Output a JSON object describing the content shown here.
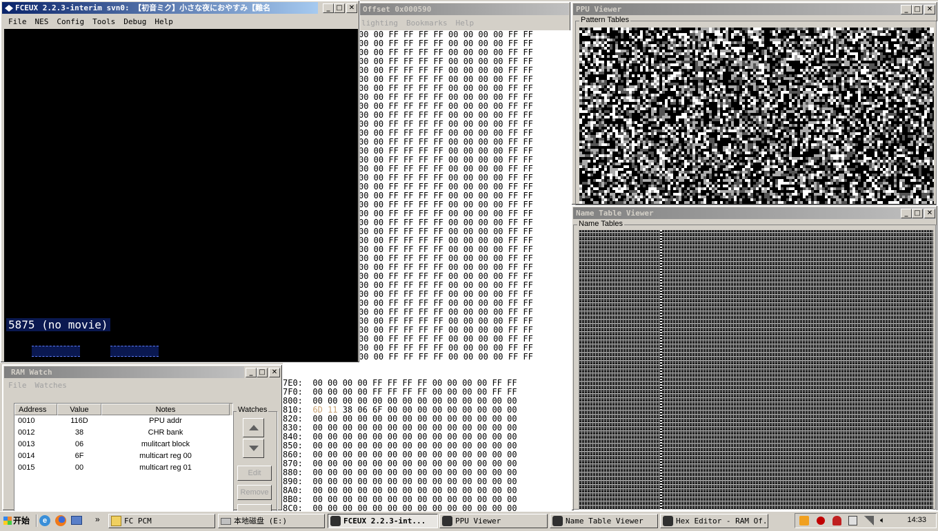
{
  "hex_editor": {
    "title": "Offset 0x000590",
    "menu": [
      "lighting",
      "Bookmarks",
      "Help"
    ],
    "ff_row": "00 00 FF FF FF FF 00 00 00 00 FF FF",
    "bottom_rows": [
      {
        "addr": "7E0:",
        "bytes": "00 00 00 00 FF FF FF FF 00 00 00 00 FF FF"
      },
      {
        "addr": "7F0:",
        "bytes": "00 00 00 00 FF FF FF FF 00 00 00 00 FF FF"
      },
      {
        "addr": "800:",
        "bytes": "00 00 00 00 00 00 00 00 00 00 00 00 00 00"
      },
      {
        "addr": "810:",
        "hl": "6D 11",
        "bytes": " 38 06 6F 00 00 00 00 00 00 00 00 00"
      },
      {
        "addr": "820:",
        "bytes": "00 00 00 00 00 00 00 00 00 00 00 00 00 00"
      },
      {
        "addr": "830:",
        "bytes": "00 00 00 00 00 00 00 00 00 00 00 00 00 00"
      },
      {
        "addr": "840:",
        "bytes": "00 00 00 00 00 00 00 00 00 00 00 00 00 00"
      },
      {
        "addr": "850:",
        "bytes": "00 00 00 00 00 00 00 00 00 00 00 00 00 00"
      },
      {
        "addr": "860:",
        "bytes": "00 00 00 00 00 00 00 00 00 00 00 00 00 00"
      },
      {
        "addr": "870:",
        "bytes": "00 00 00 00 00 00 00 00 00 00 00 00 00 00"
      },
      {
        "addr": "880:",
        "bytes": "00 00 00 00 00 00 00 00 00 00 00 00 00 00"
      },
      {
        "addr": "890:",
        "bytes": "00 00 00 00 00 00 00 00 00 00 00 00 00 00"
      },
      {
        "addr": "8A0:",
        "bytes": "00 00 00 00 00 00 00 00 00 00 00 00 00 00"
      },
      {
        "addr": "8B0:",
        "bytes": "00 00 00 00 00 00 00 00 00 00 00 00 00 00"
      },
      {
        "addr": "8C0:",
        "bytes": "00 00 00 00 00 00 00 00 00 00 00 00 00 00"
      },
      {
        "addr": "8D0:",
        "bytes": "00 00 00 00 00 00 00 00 00 00 00 00 00 00"
      }
    ]
  },
  "fceux": {
    "title": "FCEUX 2.2.3-interim svn0: 【初音ミク】小さな夜におやすみ【難名",
    "menu": [
      "File",
      "NES",
      "Config",
      "Tools",
      "Debug",
      "Help"
    ],
    "frame_counter": "5875 (no movie)"
  },
  "ppu": {
    "title": "PPU Viewer",
    "pattern_label": "Pattern Tables"
  },
  "nametable": {
    "title": "Name Table Viewer",
    "label": "Name Tables"
  },
  "ram_watch": {
    "title": "RAM Watch",
    "menu": [
      "File",
      "Watches"
    ],
    "columns": [
      "Address",
      "Value",
      "Notes"
    ],
    "rows": [
      {
        "address": "0010",
        "value": "116D",
        "notes": "PPU addr"
      },
      {
        "address": "0012",
        "value": "38",
        "notes": "CHR bank"
      },
      {
        "address": "0013",
        "value": "06",
        "notes": "mulitcart block"
      },
      {
        "address": "0014",
        "value": "6F",
        "notes": "multicart reg 00"
      },
      {
        "address": "0015",
        "value": "00",
        "notes": "multicart reg 01"
      }
    ],
    "watches_label": "Watches",
    "edit": "Edit",
    "remove": "Remove"
  },
  "taskbar": {
    "start": "开始",
    "tasks": [
      "FC PCM",
      "本地磁盘 (E:)",
      "FCEUX 2.2.3-int...",
      "PPU Viewer",
      "Name Table Viewer",
      "Hex Editor - RAM Of..."
    ],
    "clock": "14:33",
    "overflow": "»"
  },
  "colors": {
    "title_active": "#0a246a",
    "title_inactive": "#808080",
    "hex_highlight": "#c8a070"
  }
}
